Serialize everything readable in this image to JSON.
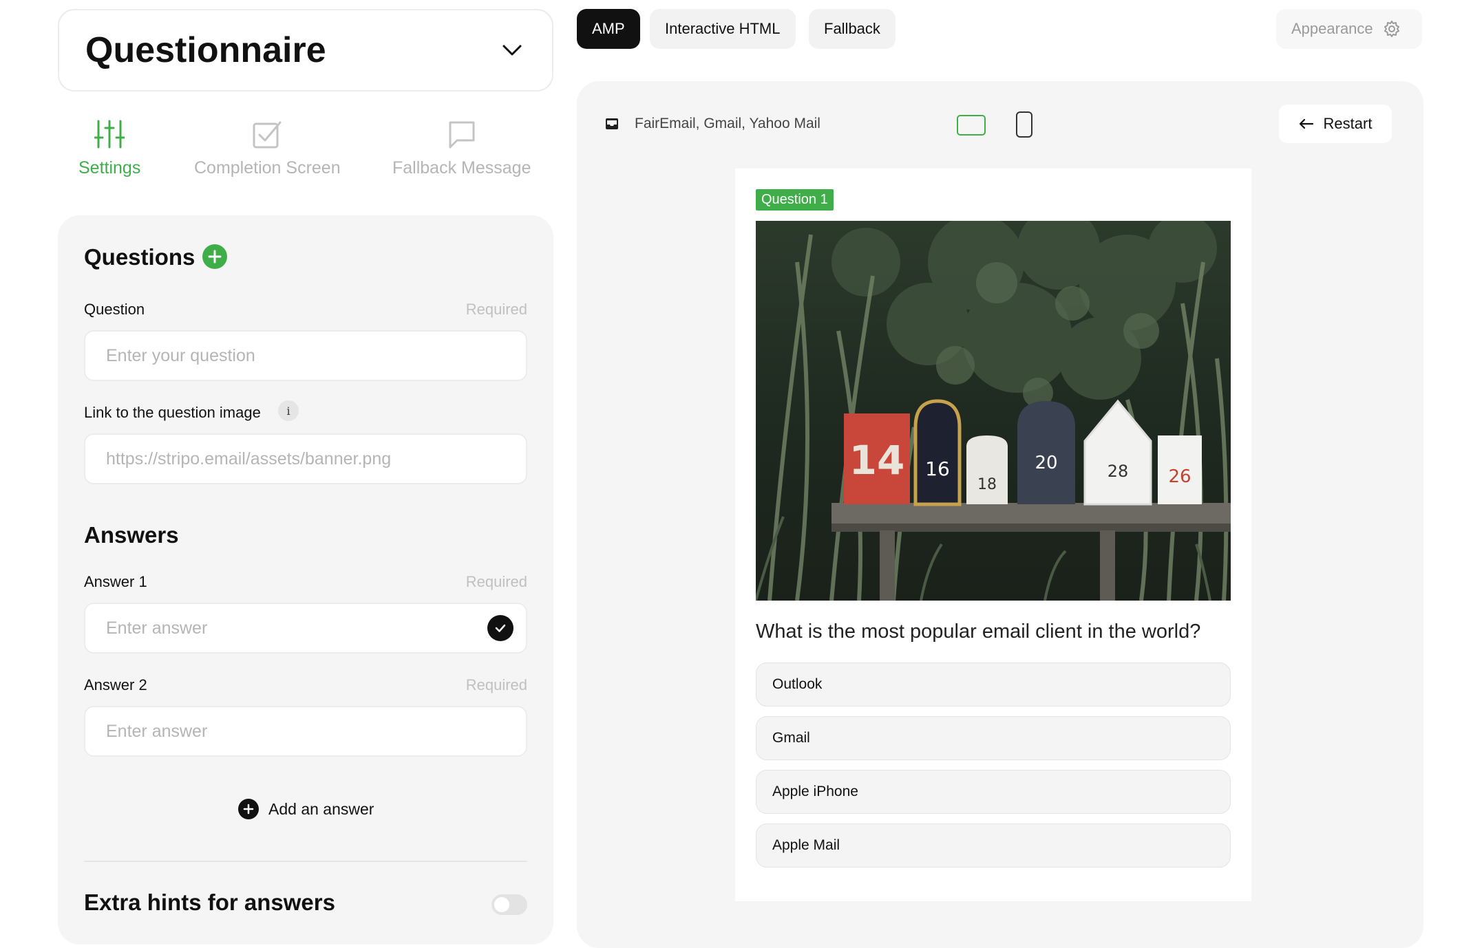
{
  "editor": {
    "block_type": "Questionnaire",
    "modes": [
      {
        "label": "Settings",
        "icon": "sliders-icon",
        "active": true
      },
      {
        "label": "Completion Screen",
        "icon": "checkbox-icon",
        "active": false
      },
      {
        "label": "Fallback Message",
        "icon": "message-icon",
        "active": false
      }
    ],
    "questions_title": "Questions",
    "question_label": "Question",
    "question_required": "Required",
    "question_placeholder": "Enter your question",
    "image_label": "Link to the question image",
    "image_info": "i",
    "image_placeholder": "https://stripo.email/assets/banner.png",
    "answers_title": "Answers",
    "answers": [
      {
        "label": "Answer 1",
        "required": "Required",
        "placeholder": "Enter answer",
        "correct": true
      },
      {
        "label": "Answer 2",
        "required": "Required",
        "placeholder": "Enter answer",
        "correct": false
      }
    ],
    "add_answer_label": "Add an answer",
    "hints_title": "Extra hints for answers",
    "hints_enabled": false
  },
  "tabs": [
    {
      "label": "AMP",
      "active": true
    },
    {
      "label": "Interactive HTML",
      "active": false
    },
    {
      "label": "Fallback",
      "active": false
    }
  ],
  "appearance_label": "Appearance",
  "preview": {
    "clients": "FairEmail, Gmail, Yahoo Mail",
    "device": "desktop",
    "restart_label": "Restart",
    "question_badge": "Question 1",
    "question_text": "What is the most popular email client in the world?",
    "options": [
      "Outlook",
      "Gmail",
      "Apple iPhone",
      "Apple Mail"
    ],
    "image_box_numbers": [
      "14",
      "16",
      "18",
      "20",
      "28",
      "26"
    ]
  },
  "colors": {
    "accent": "#3fae49",
    "dark": "#111111",
    "panel": "#f5f5f5"
  }
}
